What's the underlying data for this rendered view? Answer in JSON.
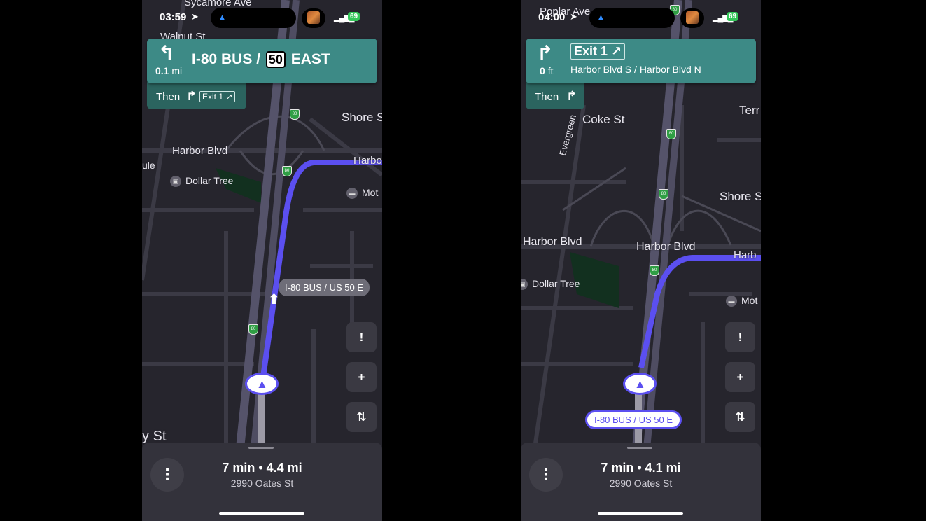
{
  "colors": {
    "route": "#5b4ff0",
    "banner": "#3d8a86",
    "then_bar": "#2b645f",
    "map_bg": "#26252d",
    "sheet": "#33323b"
  },
  "screens": [
    {
      "status": {
        "time": "03:59",
        "battery": "69"
      },
      "banner": {
        "turn_icon": "slight-left-arrow-icon",
        "distance_value": "0.1",
        "distance_unit": "mi",
        "road_prefix": "I-80 BUS /",
        "shield": "50",
        "road_suffix": "EAST",
        "then_label": "Then",
        "then_icon": "turn-right-icon",
        "then_exit": "Exit 1 ↗"
      },
      "map_labels": [
        "Sycamore Ave",
        "Walnut St",
        "Shore S",
        "Harbor Blvd",
        "ule",
        "Harbo",
        "y St"
      ],
      "pois": [
        {
          "name": "Dollar Tree",
          "icon": "shopping-bag-icon"
        },
        {
          "name": "Mot",
          "icon": "bed-icon"
        }
      ],
      "route_callout": "I-80 BUS / US 50 E",
      "sheet": {
        "eta": "7 min • 4.4 mi",
        "destination": "2990 Oates St"
      }
    },
    {
      "status": {
        "time": "04:00",
        "battery": "69"
      },
      "banner": {
        "turn_icon": "turn-right-icon",
        "distance_value": "0",
        "distance_unit": "ft",
        "exit": "Exit 1 ↗",
        "road_sub": "Harbor Blvd S / Harbor Blvd N",
        "then_label": "Then",
        "then_icon": "fork-right-icon"
      },
      "map_labels": [
        "Poplar Ave",
        "Coke St",
        "Evergreen",
        "Terr",
        "Shore S",
        "Harbor Blvd",
        "Harbor Blvd",
        "Harb"
      ],
      "pois": [
        {
          "name": "Dollar Tree",
          "icon": "shopping-bag-icon"
        },
        {
          "name": "Mot",
          "icon": "bed-icon"
        }
      ],
      "route_callout": "I-80 BUS / US 50 E",
      "sheet": {
        "eta": "7 min • 4.1 mi",
        "destination": "2990 Oates St"
      }
    }
  ],
  "buttons": {
    "report": "!",
    "safety": "+",
    "routes": "⇅",
    "more": "⋮"
  }
}
